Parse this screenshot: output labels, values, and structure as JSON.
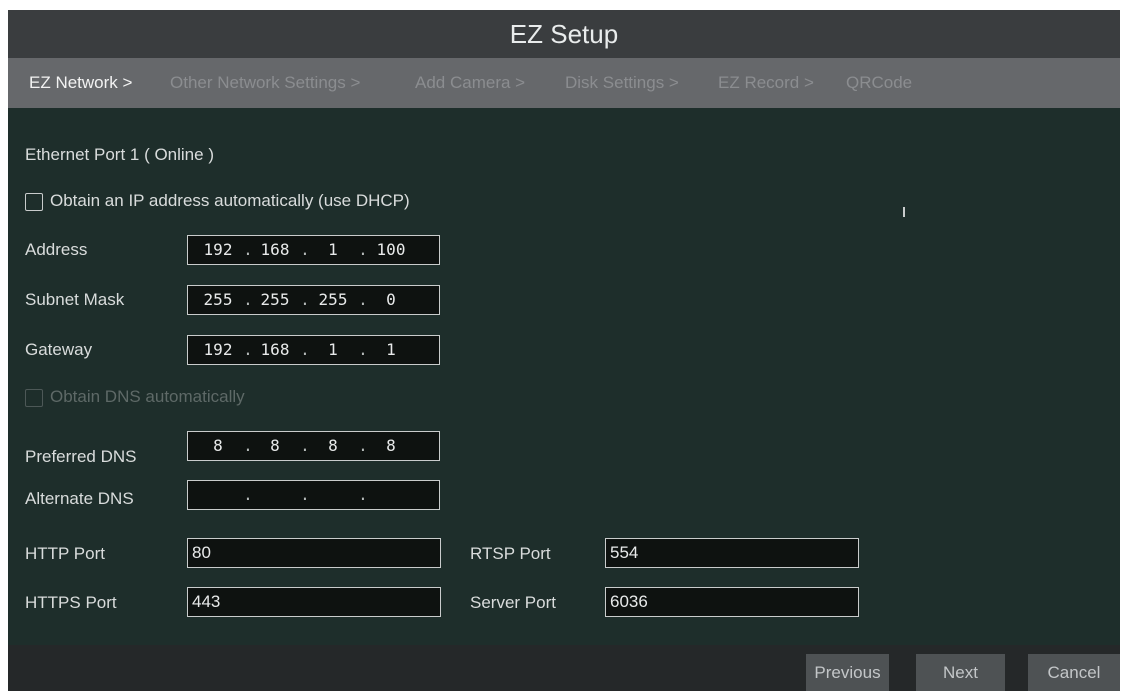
{
  "window": {
    "title": "EZ Setup"
  },
  "steps": [
    {
      "label": "EZ Network >",
      "active": true
    },
    {
      "label": "Other Network Settings >",
      "active": false
    },
    {
      "label": "Add Camera >",
      "active": false
    },
    {
      "label": "Disk Settings >",
      "active": false
    },
    {
      "label": "EZ Record >",
      "active": false
    },
    {
      "label": "QRCode",
      "active": false
    }
  ],
  "network": {
    "port_title": "Ethernet Port 1 ( Online )",
    "dhcp": {
      "label": "Obtain an IP address automatically (use DHCP)",
      "checked": false
    },
    "address": {
      "label": "Address",
      "octets": [
        "192",
        "168",
        "1",
        "100"
      ]
    },
    "subnet": {
      "label": "Subnet Mask",
      "octets": [
        "255",
        "255",
        "255",
        "0"
      ]
    },
    "gateway": {
      "label": "Gateway",
      "octets": [
        "192",
        "168",
        "1",
        "1"
      ]
    },
    "dns_auto": {
      "label": "Obtain DNS automatically",
      "checked": false,
      "enabled": false
    },
    "preferred_dns": {
      "label": "Preferred DNS",
      "octets": [
        "8",
        "8",
        "8",
        "8"
      ]
    },
    "alternate_dns": {
      "label": "Alternate DNS",
      "octets": [
        "",
        "",
        "",
        ""
      ]
    }
  },
  "ports": {
    "http": {
      "label": "HTTP Port",
      "value": "80"
    },
    "https": {
      "label": "HTTPS Port",
      "value": "443"
    },
    "rtsp": {
      "label": "RTSP Port",
      "value": "554"
    },
    "server": {
      "label": "Server Port",
      "value": "6036"
    }
  },
  "footer": {
    "previous": "Previous",
    "next": "Next",
    "cancel": "Cancel"
  }
}
